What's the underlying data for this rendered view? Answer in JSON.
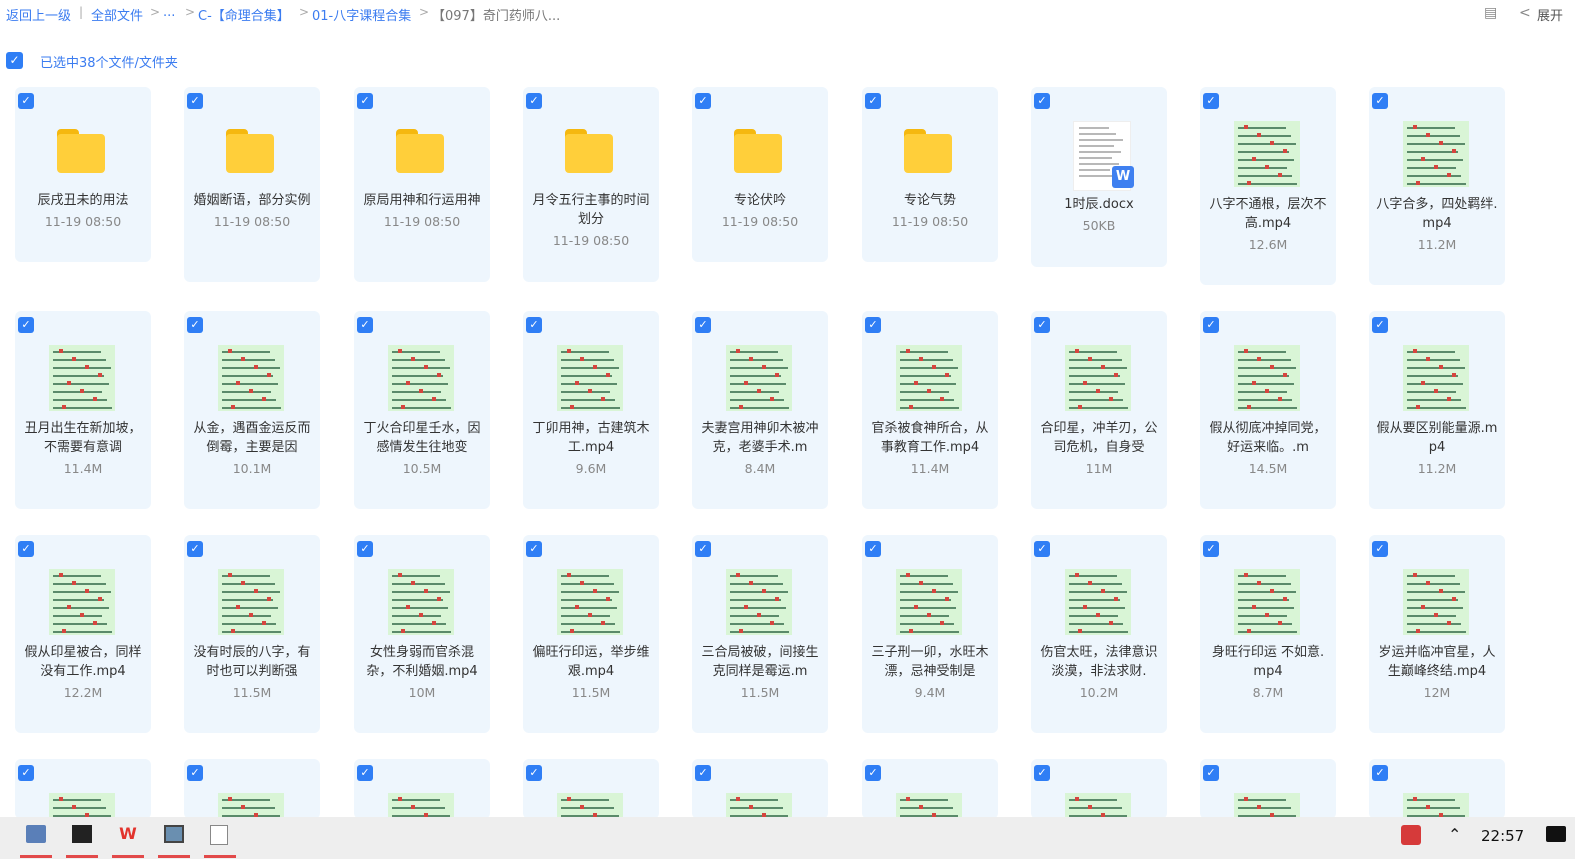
{
  "breadcrumb": {
    "back": "返回上一级",
    "items": [
      "全部文件",
      "...",
      "C-【命理合集】",
      "01-八字课程合集",
      "【097】奇门药师八..."
    ],
    "expand": "展开"
  },
  "selection": {
    "label": "已选中38个文件/文件夹"
  },
  "rows": [
    [
      {
        "type": "folder",
        "name": "辰戌丑未的用法",
        "meta": "11-19 08:50"
      },
      {
        "type": "folder",
        "name": "婚姻断语，部分实例",
        "meta": "11-19 08:50"
      },
      {
        "type": "folder",
        "name": "原局用神和行运用神",
        "meta": "11-19 08:50"
      },
      {
        "type": "folder",
        "name": "月令五行主事的时间划分",
        "meta": "11-19 08:50"
      },
      {
        "type": "folder",
        "name": "专论伏吟",
        "meta": "11-19 08:50"
      },
      {
        "type": "folder",
        "name": "专论气势",
        "meta": "11-19 08:50"
      },
      {
        "type": "doc",
        "name": "1时辰.docx",
        "meta": "50KB"
      },
      {
        "type": "video",
        "name": "八字不通根，层次不高.mp4",
        "meta": "12.6M"
      },
      {
        "type": "video",
        "name": "八字合多，四处羁绊.mp4",
        "meta": "11.2M"
      }
    ],
    [
      {
        "type": "video",
        "name": "丑月出生在新加坡，不需要有意调",
        "meta": "11.4M"
      },
      {
        "type": "video",
        "name": "从金，遇酉金运反而倒霉，主要是因",
        "meta": "10.1M"
      },
      {
        "type": "video",
        "name": "丁火合印星壬水，因感情发生往地变",
        "meta": "10.5M"
      },
      {
        "type": "video",
        "name": "丁卯用神，古建筑木工.mp4",
        "meta": "9.6M"
      },
      {
        "type": "video",
        "name": "夫妻宫用神卯木被冲克，老婆手术.m",
        "meta": "8.4M"
      },
      {
        "type": "video",
        "name": "官杀被食神所合，从事教育工作.mp4",
        "meta": "11.4M"
      },
      {
        "type": "video",
        "name": "合印星，冲羊刃，公司危机，自身受",
        "meta": "11M"
      },
      {
        "type": "video",
        "name": "假从彻底冲掉同党，好运来临。.m",
        "meta": "14.5M"
      },
      {
        "type": "video",
        "name": "假从要区别能量源.mp4",
        "meta": "11.2M"
      }
    ],
    [
      {
        "type": "video",
        "name": "假从印星被合，同样没有工作.mp4",
        "meta": "12.2M"
      },
      {
        "type": "video",
        "name": "没有时辰的八字，有时也可以判断强",
        "meta": "11.5M"
      },
      {
        "type": "video",
        "name": "女性身弱而官杀混杂，不利婚姻.mp4",
        "meta": "10M"
      },
      {
        "type": "video",
        "name": "偏旺行印运，举步维艰.mp4",
        "meta": "11.5M"
      },
      {
        "type": "video",
        "name": "三合局被破，间接生克同样是霉运.m",
        "meta": "11.5M"
      },
      {
        "type": "video",
        "name": "三子刑一卯，水旺木漂，忌神受制是",
        "meta": "9.4M"
      },
      {
        "type": "video",
        "name": "伤官太旺，法律意识淡漠，非法求财.",
        "meta": "10.2M"
      },
      {
        "type": "video",
        "name": "身旺行印运 不如意.mp4",
        "meta": "8.7M"
      },
      {
        "type": "video",
        "name": "岁运并临冲官星，人生巅峰终结.mp4",
        "meta": "12M"
      }
    ],
    [
      {
        "type": "video",
        "name": "",
        "meta": ""
      },
      {
        "type": "video",
        "name": "",
        "meta": ""
      },
      {
        "type": "video",
        "name": "",
        "meta": ""
      },
      {
        "type": "video",
        "name": "",
        "meta": ""
      },
      {
        "type": "video",
        "name": "",
        "meta": ""
      },
      {
        "type": "video",
        "name": "",
        "meta": ""
      },
      {
        "type": "video",
        "name": "",
        "meta": ""
      },
      {
        "type": "video",
        "name": "",
        "meta": ""
      },
      {
        "type": "video",
        "name": "",
        "meta": ""
      }
    ]
  ],
  "icons": {
    "check": "check-icon",
    "folder": "folder-icon",
    "doc": "word-doc-icon",
    "video": "video-thumbnail"
  },
  "colors": {
    "accent": "#2f7ef5",
    "card_bg": "#eef6fd",
    "folder": "#ffcf3a"
  },
  "taskbar": {
    "apps": [
      "computer-icon",
      "terminal-icon",
      "wps-icon",
      "window-icon",
      "notepad-icon"
    ],
    "clock": "22:57"
  }
}
